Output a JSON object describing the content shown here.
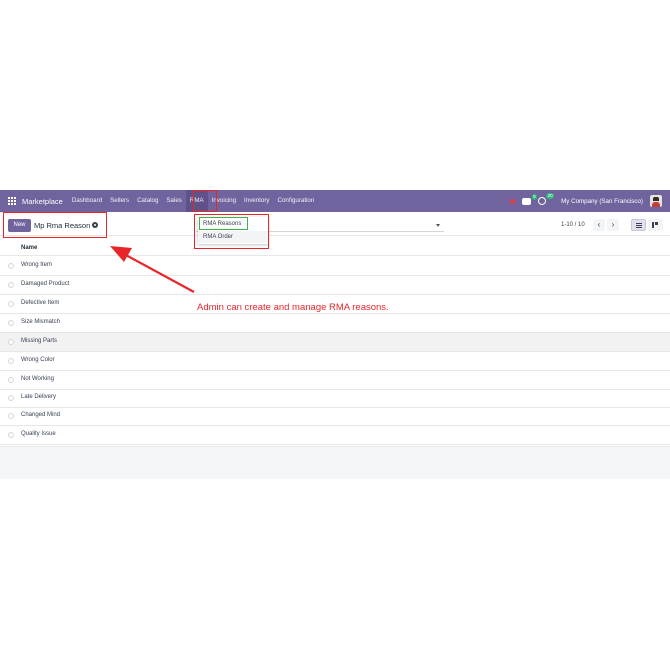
{
  "navbar": {
    "brand": "Marketplace",
    "menu": [
      {
        "label": "Dashboard"
      },
      {
        "label": "Sellers"
      },
      {
        "label": "Catalog"
      },
      {
        "label": "Sales"
      },
      {
        "label": "RMA"
      },
      {
        "label": "Invoicing"
      },
      {
        "label": "Inventory"
      },
      {
        "label": "Configuration"
      }
    ],
    "chat_badge": "9",
    "activity_badge": "20",
    "company": "My Company (San Francisco)"
  },
  "control": {
    "new_label": "New",
    "title": "Mp Rma Reason",
    "pager": "1-10 / 10",
    "prev": "‹",
    "next": "›"
  },
  "dropdown": {
    "items": [
      {
        "label": "RMA Reasons"
      },
      {
        "label": "RMA Order"
      }
    ]
  },
  "list": {
    "column": "Name",
    "rows": [
      {
        "name": "Wrong Item"
      },
      {
        "name": "Damaged Product"
      },
      {
        "name": "Defective Item"
      },
      {
        "name": "Size Mismatch"
      },
      {
        "name": "Missing Parts"
      },
      {
        "name": "Wrong Color"
      },
      {
        "name": "Not Working"
      },
      {
        "name": "Late Delivery"
      },
      {
        "name": "Changed Mind"
      },
      {
        "name": "Quality Issue"
      }
    ]
  },
  "annotation": "Admin can create and manage RMA reasons.",
  "colors": {
    "navbar": "#71639e",
    "annotation": "#e8262a",
    "highlight_box": "#3bb34a"
  }
}
